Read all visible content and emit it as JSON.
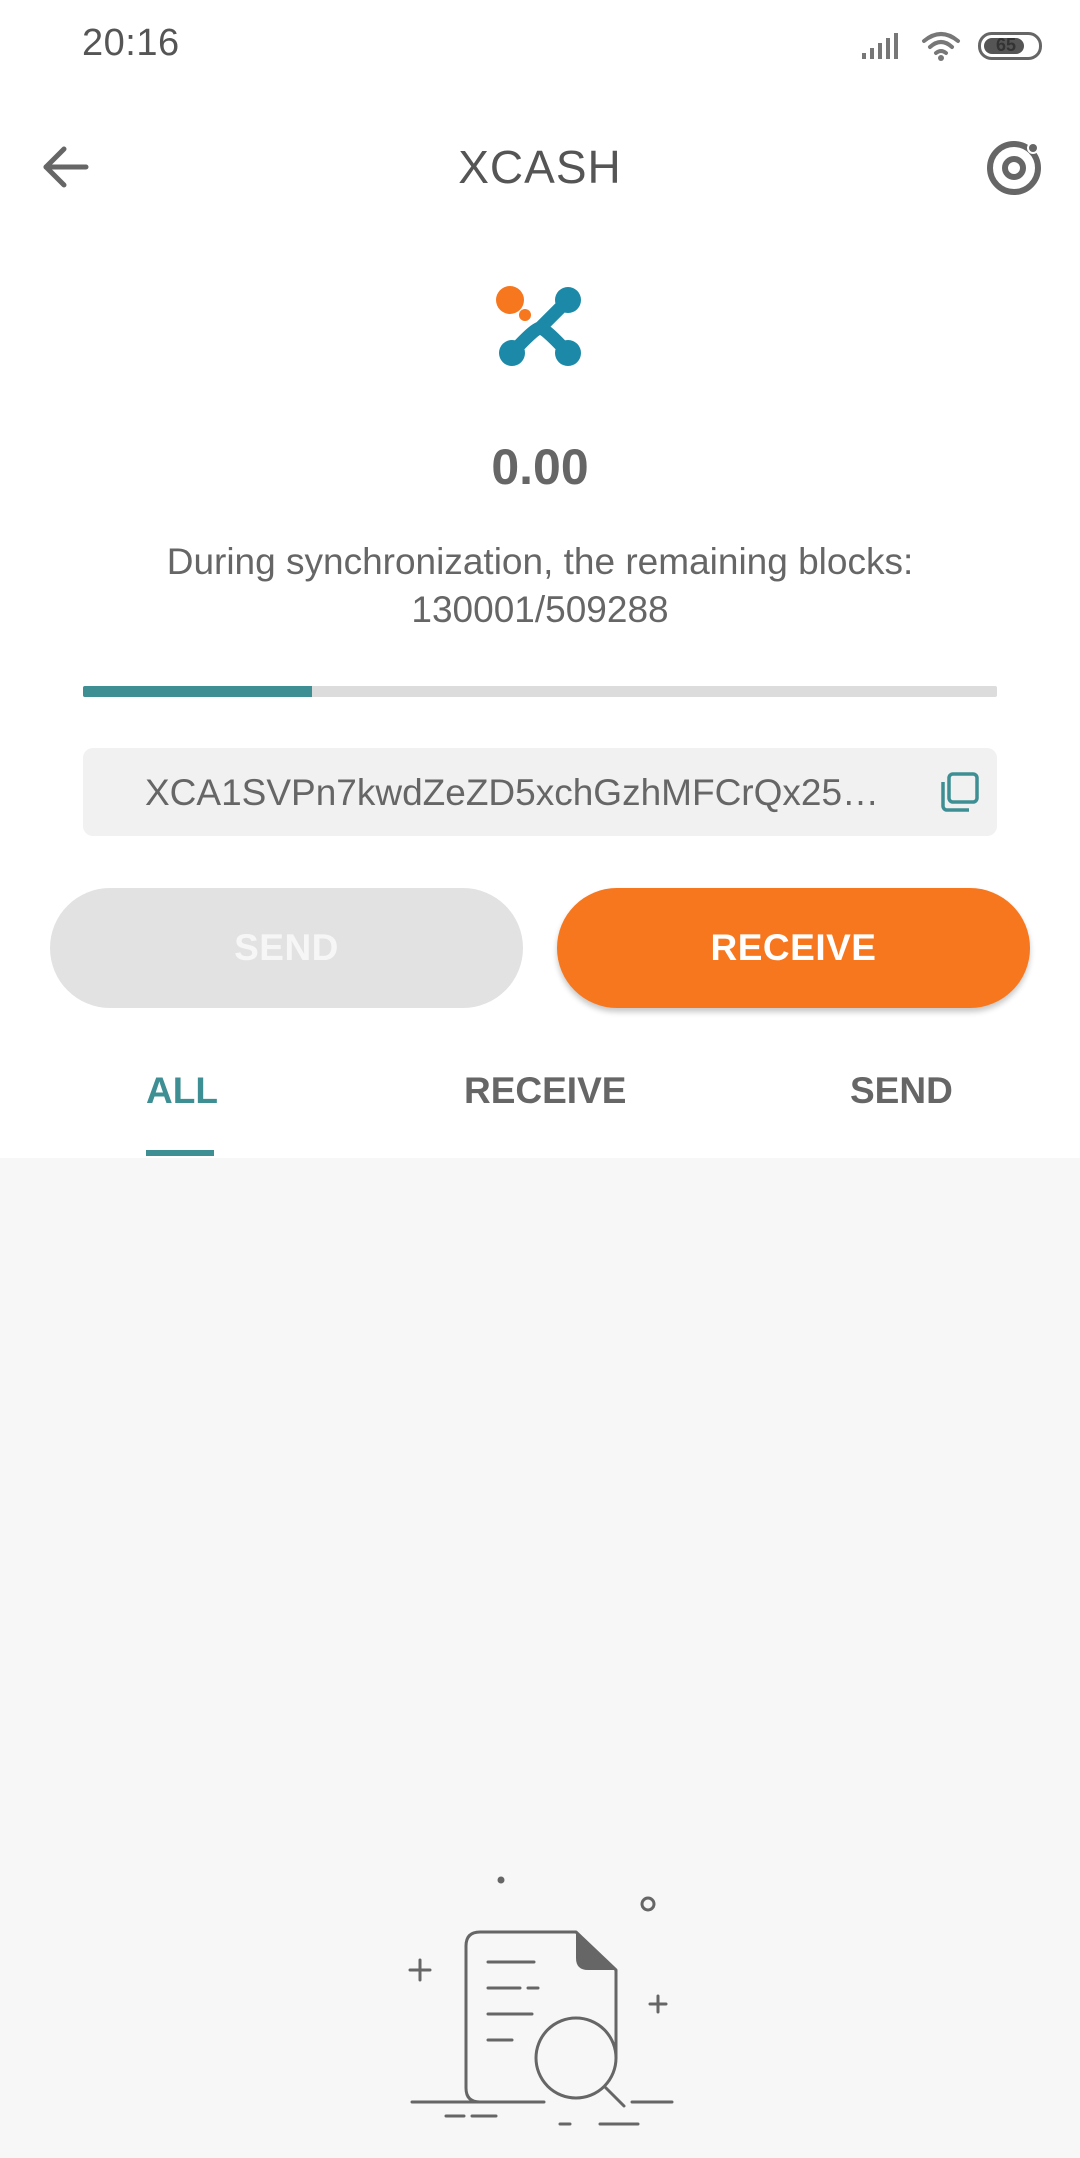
{
  "status_bar": {
    "time": "20:16",
    "battery_level": "65"
  },
  "header": {
    "title": "XCASH",
    "back_icon": "arrow-left-icon",
    "settings_icon": "settings-ring-icon"
  },
  "wallet": {
    "balance": "0.00",
    "sync_label": "During synchronization, the remaining blocks:",
    "sync_blocks": "130001/509288",
    "sync_progress": 0.25,
    "address": "XCA1SVPn7kwdZeZD5xchGzhMFCrQx25…",
    "copy_icon": "copy-icon"
  },
  "actions": {
    "send_label": "SEND",
    "receive_label": "RECEIVE"
  },
  "tabs": [
    {
      "label": "ALL",
      "active": true
    },
    {
      "label": "RECEIVE",
      "active": false
    },
    {
      "label": "SEND",
      "active": false
    }
  ],
  "colors": {
    "accent_teal": "#3e8f94",
    "accent_orange": "#f7771f",
    "logo_blue": "#1b89a7"
  }
}
